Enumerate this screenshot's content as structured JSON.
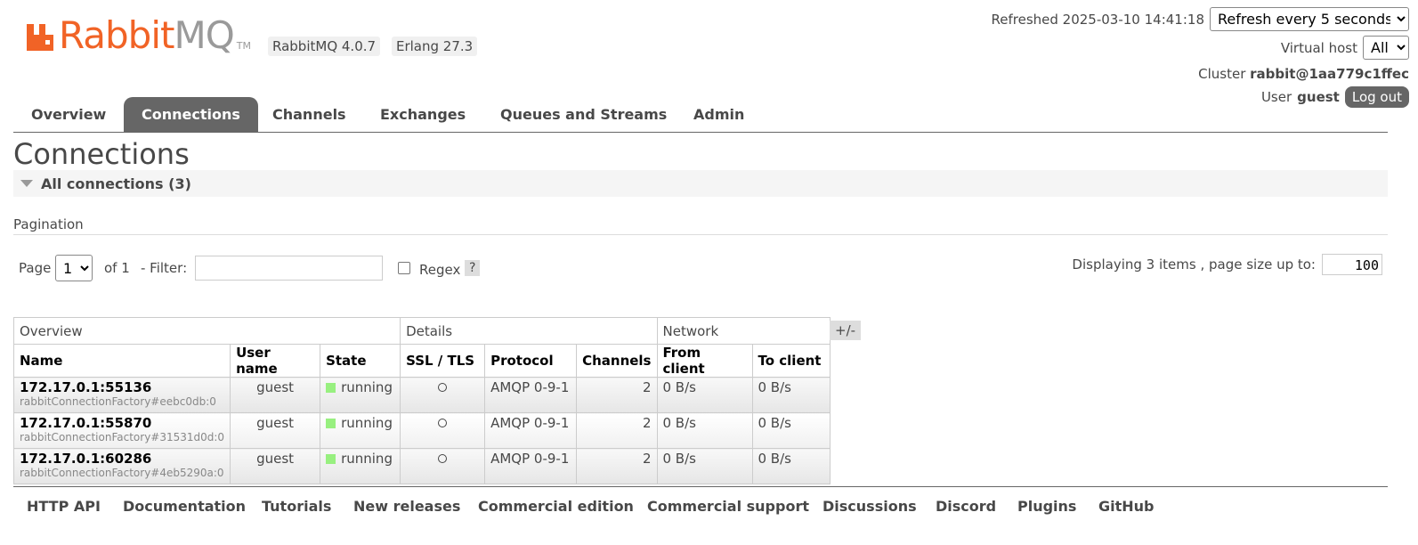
{
  "header": {
    "logo_rabbit": "Rabbit",
    "logo_mq": "MQ",
    "logo_tm": "TM",
    "rabbitmq_version": "RabbitMQ 4.0.7",
    "erlang_version": "Erlang 27.3",
    "refreshed": "Refreshed 2025-03-10 14:41:18",
    "refresh_select": "Refresh every 5 seconds",
    "vhost_label": "Virtual host",
    "vhost_select": "All",
    "cluster_label": "Cluster",
    "cluster_name": "rabbit@1aa779c1ffec",
    "user_label": "User",
    "user_name": "guest",
    "logout_label": "Log out",
    "brand_color": "#f16326"
  },
  "tabs": [
    {
      "label": "Overview"
    },
    {
      "label": "Connections",
      "active": true
    },
    {
      "label": "Channels"
    },
    {
      "label": "Exchanges"
    },
    {
      "label": "Queues and Streams"
    },
    {
      "label": "Admin"
    }
  ],
  "page": {
    "title": "Connections",
    "section_title": "All connections (3)"
  },
  "pagination": {
    "label": "Pagination",
    "page_label": "Page",
    "page_value": "1",
    "of_label": "of 1",
    "filter_label": "- Filter:",
    "filter_value": "",
    "regex_label": "Regex",
    "help_label": "?",
    "displaying": "Displaying 3 items , page size up to:",
    "page_size": "100"
  },
  "table": {
    "groups": [
      "Overview",
      "Details",
      "Network"
    ],
    "columns": [
      "Name",
      "User name",
      "State",
      "SSL / TLS",
      "Protocol",
      "Channels",
      "From client",
      "To client"
    ],
    "plusminus": "+/-",
    "rows": [
      {
        "name": "172.17.0.1:55136",
        "sub": "rabbitConnectionFactory#eebc0db:0",
        "user": "guest",
        "state": "running",
        "protocol": "AMQP 0-9-1",
        "channels": "2",
        "from_client": "0 B/s",
        "to_client": "0 B/s"
      },
      {
        "name": "172.17.0.1:55870",
        "sub": "rabbitConnectionFactory#31531d0d:0",
        "user": "guest",
        "state": "running",
        "protocol": "AMQP 0-9-1",
        "channels": "2",
        "from_client": "0 B/s",
        "to_client": "0 B/s"
      },
      {
        "name": "172.17.0.1:60286",
        "sub": "rabbitConnectionFactory#4eb5290a:0",
        "user": "guest",
        "state": "running",
        "protocol": "AMQP 0-9-1",
        "channels": "2",
        "from_client": "0 B/s",
        "to_client": "0 B/s"
      }
    ]
  },
  "footer": {
    "links": [
      "HTTP API",
      "Documentation",
      "Tutorials",
      "New releases",
      "Commercial edition",
      "Commercial support",
      "Discussions",
      "Discord",
      "Plugins",
      "GitHub"
    ]
  }
}
